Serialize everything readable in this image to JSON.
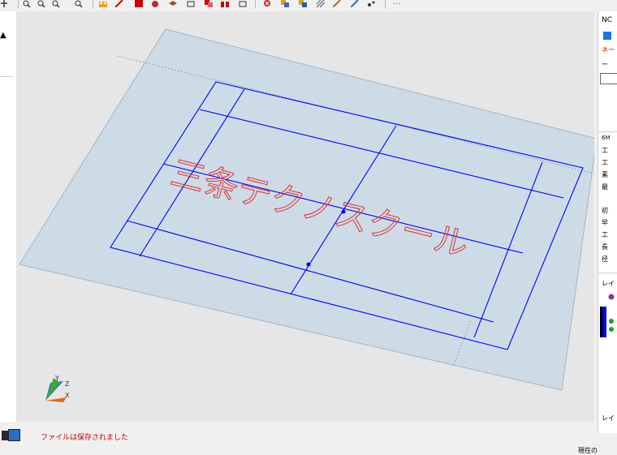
{
  "toolbar": {
    "icons": [
      "pan-icon",
      "zoom-window-icon",
      "zoom-in-icon",
      "zoom-out-icon",
      "zoom-fit-icon",
      "layer-grid-icon",
      "tool-red-icon",
      "shape-red-icon",
      "group-icon",
      "layers-brown-icon",
      "frame-icon",
      "red-copy-icon",
      "red-grid-icon",
      "move-icon",
      "cancel-icon",
      "copy-icon",
      "paste-icon",
      "hatch-icon",
      "edit-icon",
      "snap-icon",
      "point-icon"
    ],
    "more_label": "…"
  },
  "right_panel": {
    "title": "NC",
    "name_label": "ネー",
    "minus_label": "ー",
    "section_code": "6M",
    "row_labels_1": [
      "工",
      "工",
      "素",
      "最"
    ],
    "row_labels_2": [
      "初",
      "早",
      "工",
      "長",
      "径"
    ],
    "layer_label_top": "レイ",
    "layer_label_bottom": "レイ"
  },
  "viewport": {
    "plate_color": "#cddbe7",
    "line_color": "#0000ff",
    "text_color": "#e03030",
    "engraved_text": "三条テクノスクール",
    "axis_labels": {
      "y": "Y",
      "x": "X",
      "z": "Z"
    }
  },
  "status": {
    "message": "ファイルは保存されました"
  },
  "bottom_right_text": "現在の"
}
